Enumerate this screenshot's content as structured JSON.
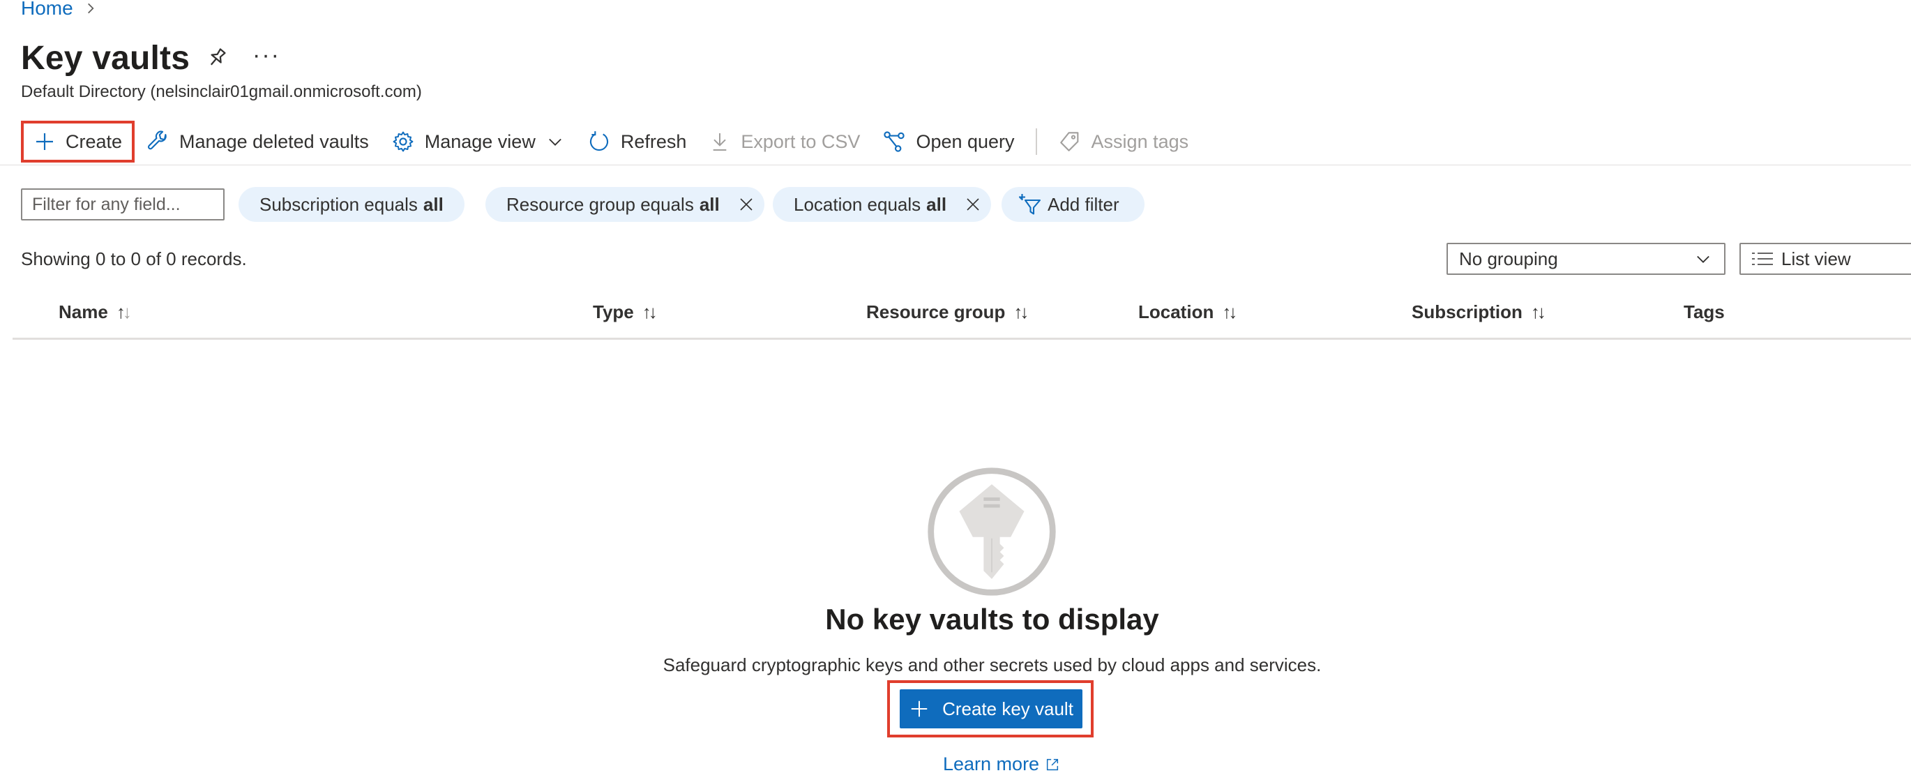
{
  "breadcrumb": {
    "home": "Home"
  },
  "page": {
    "title": "Key vaults",
    "more_label": "···",
    "subtitle": "Default Directory (nelsinclair01gmail.onmicrosoft.com)"
  },
  "toolbar": {
    "create": "Create",
    "manage_deleted": "Manage deleted vaults",
    "manage_view": "Manage view",
    "refresh": "Refresh",
    "export_csv": "Export to CSV",
    "open_query": "Open query",
    "assign_tags": "Assign tags"
  },
  "filters": {
    "placeholder": "Filter for any field...",
    "subscription": {
      "label": "Subscription equals",
      "value": "all"
    },
    "resource_group": {
      "label": "Resource group equals",
      "value": "all"
    },
    "location": {
      "label": "Location equals",
      "value": "all"
    },
    "add_filter": "Add filter"
  },
  "records_text": "Showing 0 to 0 of 0 records.",
  "grouping": {
    "selected": "No grouping"
  },
  "view": {
    "selected": "List view"
  },
  "table": {
    "columns": [
      "Name",
      "Type",
      "Resource group",
      "Location",
      "Subscription",
      "Tags"
    ]
  },
  "empty_state": {
    "title": "No key vaults to display",
    "description": "Safeguard cryptographic keys and other secrets used by cloud apps and services.",
    "cta": "Create key vault",
    "learn_more": "Learn more"
  },
  "colors": {
    "accent": "#0f6cbd",
    "highlight": "#e03e2d",
    "pill": "#e8f2fc"
  },
  "icons": [
    "chevron-right-icon",
    "pin-icon",
    "plus-icon",
    "wrench-icon",
    "gear-icon",
    "chevron-down-icon",
    "refresh-icon",
    "download-icon",
    "query-icon",
    "tag-icon",
    "close-icon",
    "add-filter-icon",
    "list-view-icon",
    "key-icon",
    "external-link-icon"
  ]
}
